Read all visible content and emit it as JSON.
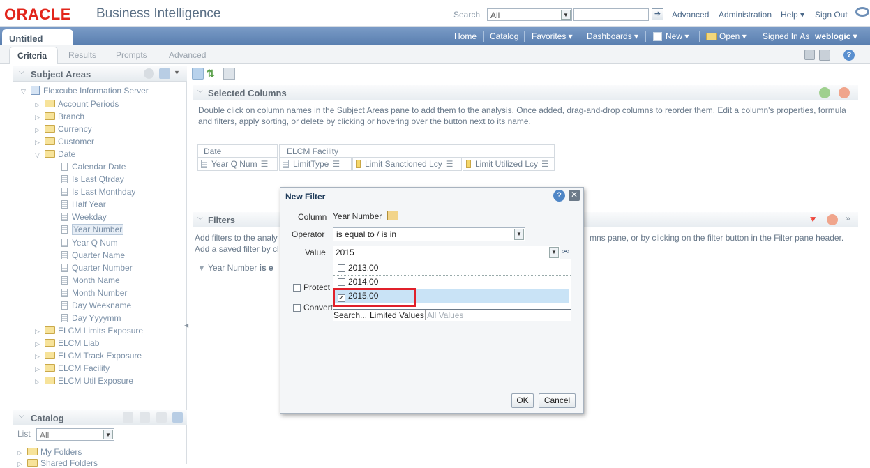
{
  "header": {
    "logo": "ORACLE",
    "product": "Business Intelligence",
    "search_label": "Search",
    "search_scope": "All",
    "search_value": "",
    "links": [
      "Advanced",
      "Administration",
      "Help ▾",
      "Sign Out"
    ]
  },
  "nav": {
    "document_tab": "Untitled",
    "links": [
      "Home",
      "Catalog",
      "Favorites ▾",
      "Dashboards ▾",
      "New ▾",
      "Open ▾"
    ],
    "signed_in_label": "Signed In As",
    "signed_in_user": "weblogic ▾"
  },
  "subtabs": [
    "Criteria",
    "Results",
    "Prompts",
    "Advanced"
  ],
  "subject_areas": {
    "title": "Subject Areas",
    "root": "Flexcube Information Server",
    "folders_before": [
      "Account Periods",
      "Branch",
      "Currency",
      "Customer"
    ],
    "date_folder": "Date",
    "date_columns": [
      "Calendar Date",
      "Is Last Qtrday",
      "Is Last Monthday",
      "Half Year",
      "Weekday",
      "Year Number",
      "Year Q Num",
      "Quarter Name",
      "Quarter Number",
      "Month Name",
      "Month Number",
      "Day Weekname",
      "Day Yyyymm"
    ],
    "folders_after": [
      "ELCM Limits Exposure",
      "ELCM Liab",
      "ELCM Track Exposure",
      "ELCM Facility",
      "ELCM Util Exposure"
    ]
  },
  "catalog": {
    "title": "Catalog",
    "list_label": "List",
    "list_value": "All",
    "items": [
      "My Folders",
      "Shared Folders"
    ]
  },
  "selected_columns": {
    "title": "Selected Columns",
    "hint": "Double click on column names in the Subject Areas pane to add them to the analysis. Once added, drag-and-drop columns to reorder them. Edit a column's properties, formula and filters, apply sorting, or delete by clicking or hovering over the button next to its name.",
    "groups": [
      "Date",
      "ELCM Facility"
    ],
    "columns": [
      "Year Q Num",
      "LimitType",
      "Limit Sanctioned Lcy",
      "Limit Utilized Lcy"
    ]
  },
  "filters": {
    "title": "Filters",
    "hint_line1": "Add filters to the analy",
    "hint_line1_right": "mns pane, or by clicking on the filter button in the Filter pane header.",
    "hint_line2": "Add a saved filter by cl",
    "filter_item_prefix": "Year Number",
    "filter_item_op": "is e"
  },
  "dialog": {
    "title": "New Filter",
    "column_label": "Column",
    "column_value": "Year Number",
    "operator_label": "Operator",
    "operator_value": "is equal to / is in",
    "value_label": "Value",
    "value_value": "2015",
    "options": [
      {
        "label": "2013.00",
        "checked": false
      },
      {
        "label": "2014.00",
        "checked": false
      },
      {
        "label": "2015.00",
        "checked": true
      }
    ],
    "footer_search": "Search...",
    "footer_limited": "Limited Values",
    "footer_all": "All Values",
    "protect_label": "Protect",
    "convert_label": "Convert",
    "ok_label": "OK",
    "cancel_label": "Cancel"
  },
  "colors": {
    "brand_red": "#e2251b",
    "nav_blue": "#5a7fb0",
    "highlight_box": "#e0202a",
    "selected_row": "#c9e3f6"
  }
}
